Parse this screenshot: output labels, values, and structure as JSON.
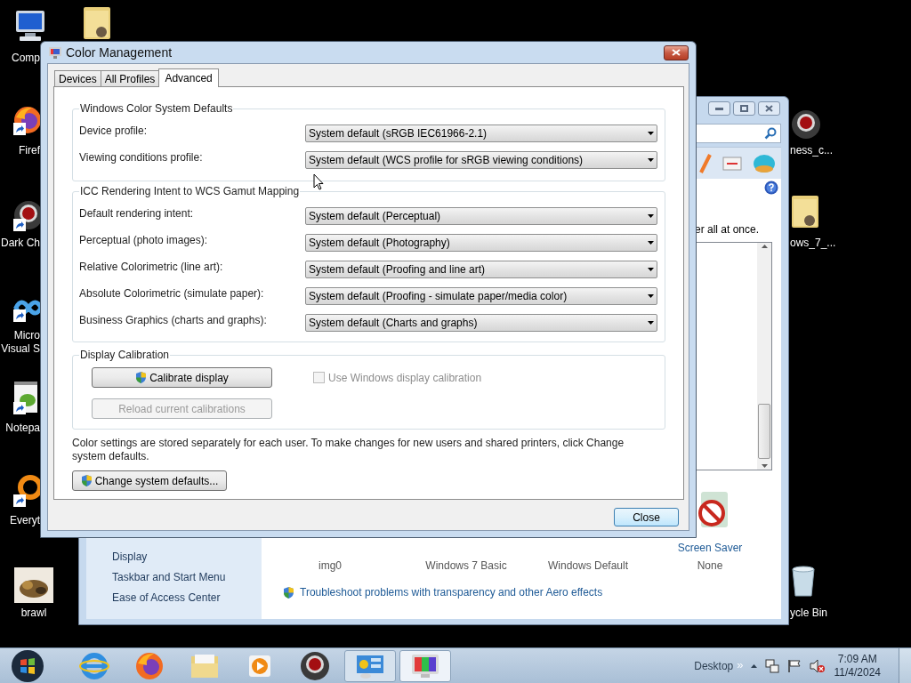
{
  "desktop_icons": [
    {
      "kind": "computer",
      "lines": [
        "Comp"
      ],
      "shortcut": false
    },
    {
      "kind": "folder",
      "shortcut": false
    },
    {
      "kind": "firefox",
      "lines": [
        "Firef"
      ],
      "shortcut": true
    },
    {
      "kind": "chrome",
      "lines": [
        "Dark Ch"
      ],
      "shortcut": true
    },
    {
      "kind": "visual-studio",
      "lines": [
        "Micro",
        "Visual S"
      ],
      "shortcut": true
    },
    {
      "kind": "notepad",
      "lines": [
        "Notepa"
      ],
      "shortcut": true
    },
    {
      "kind": "everything",
      "lines": [
        "Everyt"
      ],
      "shortcut": true
    },
    {
      "lines": [
        "brawl"
      ],
      "shortcut": false
    },
    {
      "kind": "chrome",
      "lines": [
        "ness_c..."
      ],
      "shortcut": false
    },
    {
      "kind": "folder",
      "lines": [
        "ows_7_..."
      ],
      "shortcut": false
    },
    {
      "kind": "recycle-bin",
      "lines": [
        "ycle Bin"
      ],
      "shortcut": false
    }
  ],
  "background_window": {
    "text_fragment": "er all at once.",
    "sidebar_links": [
      "Display",
      "Taskbar and Start Menu",
      "Ease of Access Center"
    ],
    "items": [
      {
        "value": "img0"
      },
      {
        "value": "Windows 7 Basic"
      },
      {
        "value": "Windows Default"
      },
      {
        "label": "Screen Saver",
        "value": "None"
      }
    ],
    "link": "Troubleshoot problems with transparency and other Aero effects"
  },
  "dialog": {
    "title": "Color Management",
    "tabs": [
      {
        "label": "Devices",
        "selected": false
      },
      {
        "label": "All Profiles",
        "selected": false
      },
      {
        "label": "Advanced",
        "selected": true
      }
    ],
    "groups": [
      {
        "title": "Windows Color System Defaults",
        "rows": [
          {
            "label": "Device profile:",
            "value": "System default (sRGB IEC61966-2.1)"
          },
          {
            "label": "Viewing conditions profile:",
            "value": "System default (WCS profile for sRGB viewing conditions)"
          }
        ]
      },
      {
        "title": "ICC Rendering Intent to WCS Gamut Mapping",
        "rows": [
          {
            "label": "Default rendering intent:",
            "value": "System default (Perceptual)"
          },
          {
            "label": "Perceptual (photo images):",
            "value": "System default (Photography)"
          },
          {
            "label": "Relative Colorimetric (line art):",
            "value": "System default (Proofing and line art)"
          },
          {
            "label": "Absolute Colorimetric (simulate paper):",
            "value": "System default (Proofing - simulate paper/media color)"
          },
          {
            "label": "Business Graphics (charts and graphs):",
            "value": "System default (Charts and graphs)"
          }
        ]
      }
    ],
    "calibration": {
      "title": "Display Calibration",
      "calibrate_button": "Calibrate display",
      "checkbox": {
        "label": "Use Windows display calibration",
        "checked": false,
        "disabled": true
      },
      "reload_button": {
        "label": "Reload current calibrations",
        "disabled": true
      }
    },
    "note": "Color settings are stored separately for each user. To make changes for new users and shared printers, click Change system defaults.",
    "change_button": "Change system defaults...",
    "close_button": "Close"
  },
  "taskbar": {
    "apps": [
      {
        "kind": "ie",
        "open": false,
        "selected": false
      },
      {
        "kind": "firefox",
        "open": false,
        "selected": false
      },
      {
        "kind": "explorer",
        "open": false,
        "selected": false
      },
      {
        "kind": "media-player",
        "open": false,
        "selected": false
      },
      {
        "kind": "chrome",
        "open": false,
        "selected": false
      },
      {
        "kind": "control-panel",
        "open": true,
        "selected": false
      },
      {
        "kind": "color-management",
        "open": true,
        "selected": true
      }
    ],
    "toolbar_label": "Desktop",
    "toolbar_chevron": "»",
    "clock_time": "7:09 AM",
    "clock_date": "11/4/2024"
  }
}
